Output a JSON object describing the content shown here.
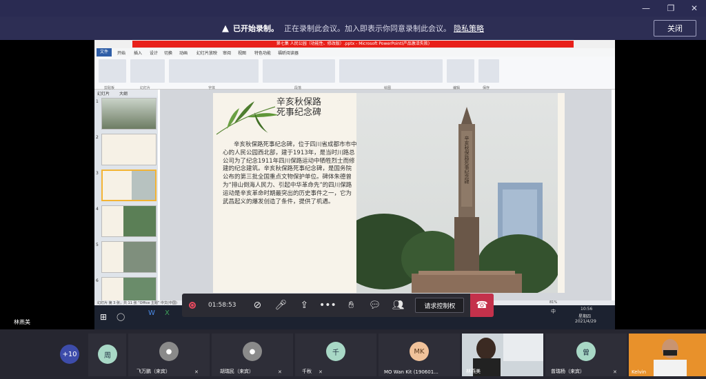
{
  "banner": {
    "title": "已开始录制。",
    "message": "正在录制此会议。加入即表示你同意录制此会议。",
    "link": "隐私策略",
    "close_label": "关闭"
  },
  "ppt": {
    "title_bar": "第七集 人民公园（功能性、修改版）.pptx - Microsoft PowerPoint(产品激活失败)",
    "menu": [
      "文件",
      "开始",
      "插入",
      "设计",
      "切换",
      "动画",
      "幻灯片放映",
      "审阅",
      "视图",
      "特色功能",
      "福昕阅读器"
    ],
    "groups": [
      "剪贴板",
      "幻灯片",
      "字体",
      "段落",
      "绘图",
      "编辑",
      "保存"
    ],
    "panel_tabs": [
      "幻灯片",
      "大纲"
    ],
    "thumb_numbers": [
      "1",
      "2",
      "3",
      "4",
      "5",
      "6"
    ],
    "slide_title_line1": "辛亥秋保路",
    "slide_title_line2": "死事纪念碑",
    "slide_body": "辛亥秋保路死事纪念碑，位于四川省成都市市中心的人民公园西北部，建于1913年，是当时川路总公司为了纪念1911年四川保路运动中牺牲烈士而修建的纪念建筑。辛亥秋保路死事纪念碑，是国务院公布的第三批全国重点文物保护单位。碑体朱德曾为“排山倒海人民力、引起中华革命先”的四川保路运动是辛亥革命时期最突出的历史事件之一，它为武昌起义的爆发创造了条件，提供了机遇。",
    "monument_text": "辛亥秋保路死事纪念碑",
    "status": "幻灯片 第 3 张，共 11 张   “Office 主题”   中文(中国)",
    "zoom": "81%"
  },
  "taskbar": {
    "time": "10:56",
    "weekday": "星期四",
    "date": "2021/4/29",
    "ime": "中"
  },
  "call": {
    "timer": "01:58:53",
    "request_control": "请求控制权",
    "sharer_name": "林燕美"
  },
  "participants": [
    {
      "initials": "+10",
      "name": "",
      "color": "#3d4caa"
    },
    {
      "initials": "周",
      "name": "",
      "color": "#a8d8c6"
    },
    {
      "initials": "",
      "name": "飞万鹏（来宾）",
      "color": "#8a8a8a"
    },
    {
      "initials": "",
      "name": "胡瑞民（来宾）",
      "color": "#8a8a8a"
    },
    {
      "initials": "千",
      "name": "千秋",
      "color": "#a8d8c6"
    },
    {
      "initials": "MK",
      "name": "MO Wan Kit (190601...",
      "color": "#f0c29a"
    },
    {
      "initials": "",
      "name": "林燕美",
      "color": "#555"
    },
    {
      "initials": "曾",
      "name": "曾瑞杨（来宾）",
      "color": "#a8d8c6"
    },
    {
      "initials": "",
      "name": "Kelvin",
      "color": "#555"
    }
  ],
  "colors": {
    "banner_bg": "#2d2e54",
    "hangup": "#c4314b",
    "ppt_title_red": "#e8201a",
    "selected_thumb": "#f3b434"
  }
}
